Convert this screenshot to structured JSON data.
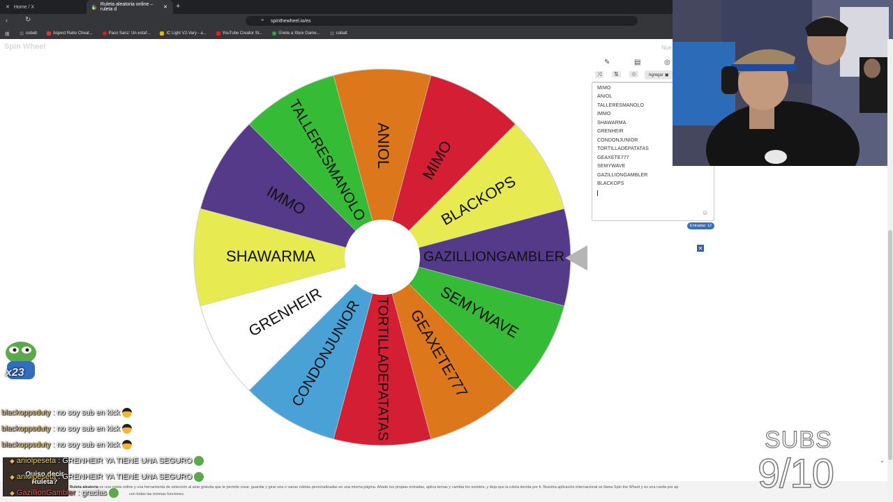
{
  "browser": {
    "tabs": [
      {
        "label": "Home / X"
      },
      {
        "label": "Ruleta aleatoria online – ruleta d"
      }
    ],
    "url": "spinthewheel.io/es",
    "bookmarks": [
      {
        "label": "cobalt",
        "color": "#555555"
      },
      {
        "label": "Aspect Ratio Cheat...",
        "color": "#d33c3c"
      },
      {
        "label": "Paco Sanz: Un estaf...",
        "color": "#cc2222"
      },
      {
        "label": "IC Light V2-Vary - a...",
        "color": "#f0b400"
      },
      {
        "label": "YouTube Creator St...",
        "color": "#e62117"
      },
      {
        "label": "Únete a Xbox Game...",
        "color": "#2aa84a"
      },
      {
        "label": "cobalt",
        "color": "#555555"
      }
    ]
  },
  "site": {
    "logo": "Spin Wheel",
    "corner_text": "Nue"
  },
  "wheel": {
    "segments": [
      {
        "label": "GAZILLIONGAMBLER",
        "color": "#563a8a"
      },
      {
        "label": "SEMYWAVE",
        "color": "#35bb35"
      },
      {
        "label": "GEAXETE777",
        "color": "#dd771b"
      },
      {
        "label": "TORTILLADEPATATAS",
        "color": "#d41e34"
      },
      {
        "label": "CONDONJUNIOR",
        "color": "#4aa1d6"
      },
      {
        "label": "GRENHEIR",
        "color": "#ffffff"
      },
      {
        "label": "SHAWARMA",
        "color": "#e8ea52"
      },
      {
        "label": "IMMO",
        "color": "#563a8a"
      },
      {
        "label": "TALLERESMANOLO",
        "color": "#35bb35"
      },
      {
        "label": "ANIOL",
        "color": "#dd771b"
      },
      {
        "label": "MIMO",
        "color": "#d41e34"
      },
      {
        "label": "BLACKOPS",
        "color": "#e8ea52"
      }
    ]
  },
  "panel": {
    "add_label": "Agregar",
    "entries": [
      "MIMO",
      "ANIOL",
      "TALLERESMANOLO",
      "IMMO",
      "SHAWARMA",
      "GRENHEIR",
      "CONDONJUNIOR",
      "TORTILLADEPATATAS",
      "GEAXETE777",
      "SEMYWAVE",
      "GAZILLIONGAMBLER",
      "BLACKOPS"
    ],
    "count_label": "Entradas: 12"
  },
  "chat": [
    {
      "user": "blackoppsduty",
      "message": ": no soy sub en kick"
    },
    {
      "user": "blackoppsduty",
      "message": ": no soy sub en kick"
    },
    {
      "user": "blackoppsduty",
      "message": ": no soy sub en kick"
    },
    {
      "user": "aniolpeseta",
      "message": ": GRENHEIR YA TIENE UNA SEGURO"
    },
    {
      "user": "aniolpeseta",
      "message": ": GRENHEIR YA TIENE UNA SEGURO"
    },
    {
      "user": "GazillionGambler",
      "message": ": gracias"
    }
  ],
  "overlay": {
    "frog_badge": "x23",
    "popup_text": "Quiso decir Ruleta?",
    "subs_label": "SUBS",
    "subs_count": "9/10"
  },
  "footer": {
    "bold": "Ruleta aleatoria",
    "line1": " es una ruleta online y una herramienta de selección al azar gratuita que te permite crear, guardar y girar una o varias ruletas personalizadas en una misma página. Añade tus propias entradas, aplica temas y cambia los sonidos, y deja que la ruleta decida por ti. Nuestra aplicación internacional se llama Spin the Wheel y es una rueda por ap",
    "line2": "con todas las mismas funciones."
  }
}
